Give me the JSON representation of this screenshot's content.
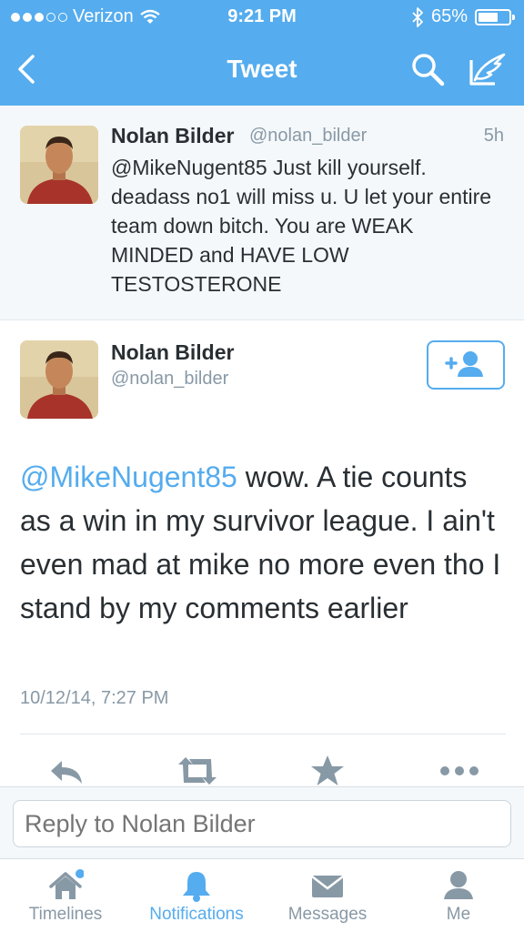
{
  "status_bar": {
    "carrier": "Verizon",
    "time": "9:21 PM",
    "battery": "65%",
    "battery_level": 0.65,
    "signal_bars_filled": 3,
    "signal_bars_total": 5
  },
  "nav": {
    "title": "Tweet",
    "back_icon": "chevron-left-icon",
    "search_icon": "search-icon",
    "compose_icon": "compose-icon"
  },
  "previous_tweet": {
    "name": "Nolan Bilder",
    "handle": "@nolan_bilder",
    "time": "5h",
    "text": "@MikeNugent85 Just kill yourself. deadass no1 will miss u. U let your entire team down bitch. You are WEAK MINDED and HAVE LOW TESTOSTERONE"
  },
  "main_tweet": {
    "name": "Nolan Bilder",
    "handle": "@nolan_bilder",
    "mention": "@MikeNugent85",
    "text": " wow. A tie counts as a win in my survivor league. I ain't even mad at mike no more even tho I stand by my comments earlier",
    "timestamp": "10/12/14, 7:27 PM",
    "follow_icon": "add-user-icon"
  },
  "actions": {
    "reply_icon": "reply-icon",
    "retweet_icon": "retweet-icon",
    "favorite_icon": "star-icon",
    "more_icon": "more-icon"
  },
  "reply_bar": {
    "placeholder": "Reply to Nolan Bilder"
  },
  "tabs": [
    {
      "label": "Timelines",
      "icon": "home-icon",
      "active": false
    },
    {
      "label": "Notifications",
      "icon": "bell-icon",
      "active": true
    },
    {
      "label": "Messages",
      "icon": "envelope-icon",
      "active": false
    },
    {
      "label": "Me",
      "icon": "person-icon",
      "active": false
    }
  ],
  "colors": {
    "brand": "#55acee",
    "text": "#292f33",
    "muted": "#8899a6",
    "icon_gray": "#8899a6"
  }
}
